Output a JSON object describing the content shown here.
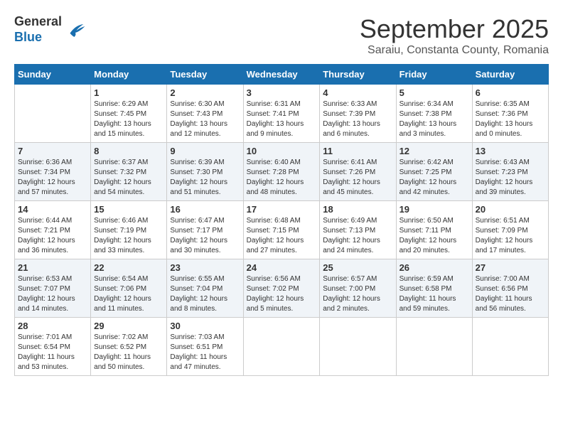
{
  "header": {
    "logo": {
      "general": "General",
      "blue": "Blue"
    },
    "month": "September 2025",
    "location": "Saraiu, Constanta County, Romania"
  },
  "days_of_week": [
    "Sunday",
    "Monday",
    "Tuesday",
    "Wednesday",
    "Thursday",
    "Friday",
    "Saturday"
  ],
  "weeks": [
    [
      {
        "day": "",
        "info": ""
      },
      {
        "day": "1",
        "info": "Sunrise: 6:29 AM\nSunset: 7:45 PM\nDaylight: 13 hours\nand 15 minutes."
      },
      {
        "day": "2",
        "info": "Sunrise: 6:30 AM\nSunset: 7:43 PM\nDaylight: 13 hours\nand 12 minutes."
      },
      {
        "day": "3",
        "info": "Sunrise: 6:31 AM\nSunset: 7:41 PM\nDaylight: 13 hours\nand 9 minutes."
      },
      {
        "day": "4",
        "info": "Sunrise: 6:33 AM\nSunset: 7:39 PM\nDaylight: 13 hours\nand 6 minutes."
      },
      {
        "day": "5",
        "info": "Sunrise: 6:34 AM\nSunset: 7:38 PM\nDaylight: 13 hours\nand 3 minutes."
      },
      {
        "day": "6",
        "info": "Sunrise: 6:35 AM\nSunset: 7:36 PM\nDaylight: 13 hours\nand 0 minutes."
      }
    ],
    [
      {
        "day": "7",
        "info": "Sunrise: 6:36 AM\nSunset: 7:34 PM\nDaylight: 12 hours\nand 57 minutes."
      },
      {
        "day": "8",
        "info": "Sunrise: 6:37 AM\nSunset: 7:32 PM\nDaylight: 12 hours\nand 54 minutes."
      },
      {
        "day": "9",
        "info": "Sunrise: 6:39 AM\nSunset: 7:30 PM\nDaylight: 12 hours\nand 51 minutes."
      },
      {
        "day": "10",
        "info": "Sunrise: 6:40 AM\nSunset: 7:28 PM\nDaylight: 12 hours\nand 48 minutes."
      },
      {
        "day": "11",
        "info": "Sunrise: 6:41 AM\nSunset: 7:26 PM\nDaylight: 12 hours\nand 45 minutes."
      },
      {
        "day": "12",
        "info": "Sunrise: 6:42 AM\nSunset: 7:25 PM\nDaylight: 12 hours\nand 42 minutes."
      },
      {
        "day": "13",
        "info": "Sunrise: 6:43 AM\nSunset: 7:23 PM\nDaylight: 12 hours\nand 39 minutes."
      }
    ],
    [
      {
        "day": "14",
        "info": "Sunrise: 6:44 AM\nSunset: 7:21 PM\nDaylight: 12 hours\nand 36 minutes."
      },
      {
        "day": "15",
        "info": "Sunrise: 6:46 AM\nSunset: 7:19 PM\nDaylight: 12 hours\nand 33 minutes."
      },
      {
        "day": "16",
        "info": "Sunrise: 6:47 AM\nSunset: 7:17 PM\nDaylight: 12 hours\nand 30 minutes."
      },
      {
        "day": "17",
        "info": "Sunrise: 6:48 AM\nSunset: 7:15 PM\nDaylight: 12 hours\nand 27 minutes."
      },
      {
        "day": "18",
        "info": "Sunrise: 6:49 AM\nSunset: 7:13 PM\nDaylight: 12 hours\nand 24 minutes."
      },
      {
        "day": "19",
        "info": "Sunrise: 6:50 AM\nSunset: 7:11 PM\nDaylight: 12 hours\nand 20 minutes."
      },
      {
        "day": "20",
        "info": "Sunrise: 6:51 AM\nSunset: 7:09 PM\nDaylight: 12 hours\nand 17 minutes."
      }
    ],
    [
      {
        "day": "21",
        "info": "Sunrise: 6:53 AM\nSunset: 7:07 PM\nDaylight: 12 hours\nand 14 minutes."
      },
      {
        "day": "22",
        "info": "Sunrise: 6:54 AM\nSunset: 7:06 PM\nDaylight: 12 hours\nand 11 minutes."
      },
      {
        "day": "23",
        "info": "Sunrise: 6:55 AM\nSunset: 7:04 PM\nDaylight: 12 hours\nand 8 minutes."
      },
      {
        "day": "24",
        "info": "Sunrise: 6:56 AM\nSunset: 7:02 PM\nDaylight: 12 hours\nand 5 minutes."
      },
      {
        "day": "25",
        "info": "Sunrise: 6:57 AM\nSunset: 7:00 PM\nDaylight: 12 hours\nand 2 minutes."
      },
      {
        "day": "26",
        "info": "Sunrise: 6:59 AM\nSunset: 6:58 PM\nDaylight: 11 hours\nand 59 minutes."
      },
      {
        "day": "27",
        "info": "Sunrise: 7:00 AM\nSunset: 6:56 PM\nDaylight: 11 hours\nand 56 minutes."
      }
    ],
    [
      {
        "day": "28",
        "info": "Sunrise: 7:01 AM\nSunset: 6:54 PM\nDaylight: 11 hours\nand 53 minutes."
      },
      {
        "day": "29",
        "info": "Sunrise: 7:02 AM\nSunset: 6:52 PM\nDaylight: 11 hours\nand 50 minutes."
      },
      {
        "day": "30",
        "info": "Sunrise: 7:03 AM\nSunset: 6:51 PM\nDaylight: 11 hours\nand 47 minutes."
      },
      {
        "day": "",
        "info": ""
      },
      {
        "day": "",
        "info": ""
      },
      {
        "day": "",
        "info": ""
      },
      {
        "day": "",
        "info": ""
      }
    ]
  ]
}
